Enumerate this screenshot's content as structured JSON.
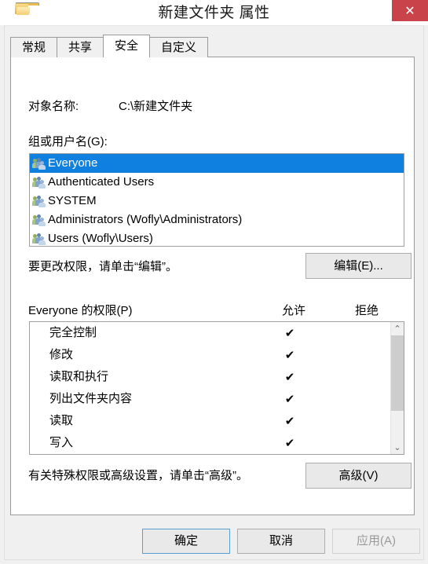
{
  "window": {
    "title": "新建文件夹 属性",
    "folder_icon": "folder-icon",
    "close_label": "✕"
  },
  "tabs": [
    {
      "label": "常规",
      "active": false
    },
    {
      "label": "共享",
      "active": false
    },
    {
      "label": "安全",
      "active": true
    },
    {
      "label": "自定义",
      "active": false
    }
  ],
  "security": {
    "object_name_label": "对象名称:",
    "object_name_value": "C:\\新建文件夹",
    "group_label": "组或用户名(G):",
    "users": [
      {
        "name": "Everyone",
        "selected": true
      },
      {
        "name": "Authenticated Users",
        "selected": false
      },
      {
        "name": "SYSTEM",
        "selected": false
      },
      {
        "name": "Administrators (Wofly\\Administrators)",
        "selected": false
      },
      {
        "name": "Users (Wofly\\Users)",
        "selected": false
      }
    ],
    "edit_hint": "要更改权限，请单击“编辑”。",
    "edit_button": "编辑(E)...",
    "permissions_header": "Everyone 的权限(P)",
    "column_allow": "允许",
    "column_deny": "拒绝",
    "check_mark": "✔",
    "permissions": [
      {
        "name": "完全控制",
        "allow": true,
        "deny": false
      },
      {
        "name": "修改",
        "allow": true,
        "deny": false
      },
      {
        "name": "读取和执行",
        "allow": true,
        "deny": false
      },
      {
        "name": "列出文件夹内容",
        "allow": true,
        "deny": false
      },
      {
        "name": "读取",
        "allow": true,
        "deny": false
      },
      {
        "name": "写入",
        "allow": true,
        "deny": false
      }
    ],
    "advanced_hint": "有关特殊权限或高级设置，请单击“高级”。",
    "advanced_button": "高级(V)",
    "scroll_up": "⌃",
    "scroll_down": "⌄"
  },
  "footer": {
    "ok": "确定",
    "cancel": "取消",
    "apply": "应用(A)"
  },
  "colors": {
    "selection_blue": "#0f80e0",
    "close_red": "#c9434a",
    "dialog_gray": "#f0f0f0",
    "focus_border": "#5a9fd4"
  }
}
